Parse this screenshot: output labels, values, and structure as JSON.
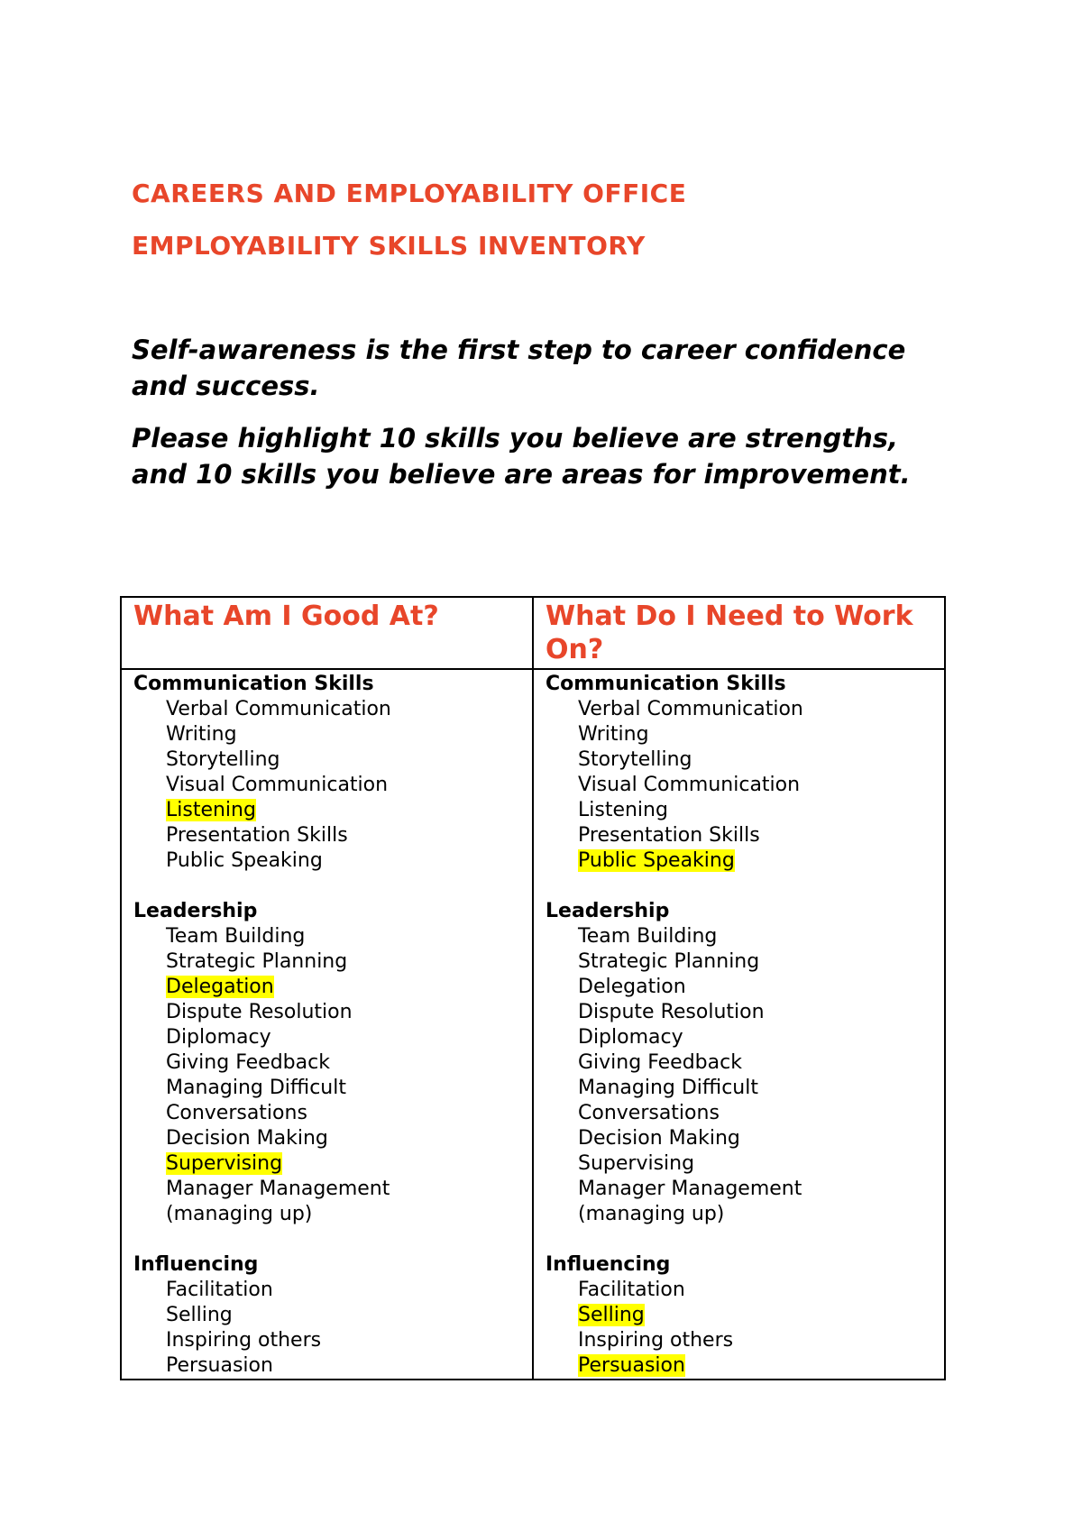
{
  "header": {
    "line1": "CAREERS AND EMPLOYABILITY OFFICE",
    "line2": "EMPLOYABILITY SKILLS INVENTORY"
  },
  "intro": {
    "p1": "Self-awareness is the first step to career confidence and success.",
    "p2": "Please highlight 10 skills you believe are strengths, and 10 skills you believe are areas for improvement."
  },
  "colors": {
    "accent": "#e8462a",
    "highlight": "#ffff00"
  },
  "table": {
    "columns": [
      {
        "header": "What Am I Good At?",
        "groups": [
          {
            "title": "Communication Skills",
            "items": [
              {
                "label": "Verbal Communication",
                "highlighted": false
              },
              {
                "label": "Writing",
                "highlighted": false
              },
              {
                "label": "Storytelling",
                "highlighted": false
              },
              {
                "label": "Visual Communication",
                "highlighted": false
              },
              {
                "label": "Listening",
                "highlighted": true
              },
              {
                "label": "Presentation Skills",
                "highlighted": false
              },
              {
                "label": "Public Speaking",
                "highlighted": false
              }
            ]
          },
          {
            "title": "Leadership",
            "items": [
              {
                "label": "Team Building",
                "highlighted": false
              },
              {
                "label": "Strategic Planning",
                "highlighted": false
              },
              {
                "label": "Delegation",
                "highlighted": true
              },
              {
                "label": "Dispute Resolution",
                "highlighted": false
              },
              {
                "label": "Diplomacy",
                "highlighted": false
              },
              {
                "label": "Giving Feedback",
                "highlighted": false
              },
              {
                "label": "Managing Difficult",
                "highlighted": false
              },
              {
                "label": "Conversations",
                "highlighted": false
              },
              {
                "label": "Decision Making",
                "highlighted": false
              },
              {
                "label": "Supervising",
                "highlighted": true
              },
              {
                "label": "Manager Management",
                "highlighted": false
              },
              {
                "label": "(managing up)",
                "highlighted": false
              }
            ]
          },
          {
            "title": "Influencing",
            "items": [
              {
                "label": "Facilitation",
                "highlighted": false
              },
              {
                "label": "Selling",
                "highlighted": false
              },
              {
                "label": "Inspiring others",
                "highlighted": false
              },
              {
                "label": "Persuasion",
                "highlighted": false
              }
            ]
          }
        ]
      },
      {
        "header": "What Do I Need to Work On?",
        "groups": [
          {
            "title": "Communication Skills",
            "items": [
              {
                "label": "Verbal Communication",
                "highlighted": false
              },
              {
                "label": "Writing",
                "highlighted": false
              },
              {
                "label": "Storytelling",
                "highlighted": false
              },
              {
                "label": "Visual Communication",
                "highlighted": false
              },
              {
                "label": "Listening",
                "highlighted": false
              },
              {
                "label": "Presentation Skills",
                "highlighted": false
              },
              {
                "label": "Public Speaking",
                "highlighted": true
              }
            ]
          },
          {
            "title": "Leadership",
            "items": [
              {
                "label": "Team Building",
                "highlighted": false
              },
              {
                "label": "Strategic Planning",
                "highlighted": false
              },
              {
                "label": "Delegation",
                "highlighted": false
              },
              {
                "label": "Dispute Resolution",
                "highlighted": false
              },
              {
                "label": "Diplomacy",
                "highlighted": false
              },
              {
                "label": "Giving Feedback",
                "highlighted": false
              },
              {
                "label": "Managing Difficult",
                "highlighted": false
              },
              {
                "label": "Conversations",
                "highlighted": false
              },
              {
                "label": "Decision Making",
                "highlighted": false
              },
              {
                "label": "Supervising",
                "highlighted": false
              },
              {
                "label": "Manager Management",
                "highlighted": false
              },
              {
                "label": "(managing up)",
                "highlighted": false
              }
            ]
          },
          {
            "title": "Influencing",
            "items": [
              {
                "label": "Facilitation",
                "highlighted": false
              },
              {
                "label": "Selling",
                "highlighted": true
              },
              {
                "label": "Inspiring others",
                "highlighted": false
              },
              {
                "label": "Persuasion",
                "highlighted": true
              }
            ]
          }
        ]
      }
    ]
  }
}
